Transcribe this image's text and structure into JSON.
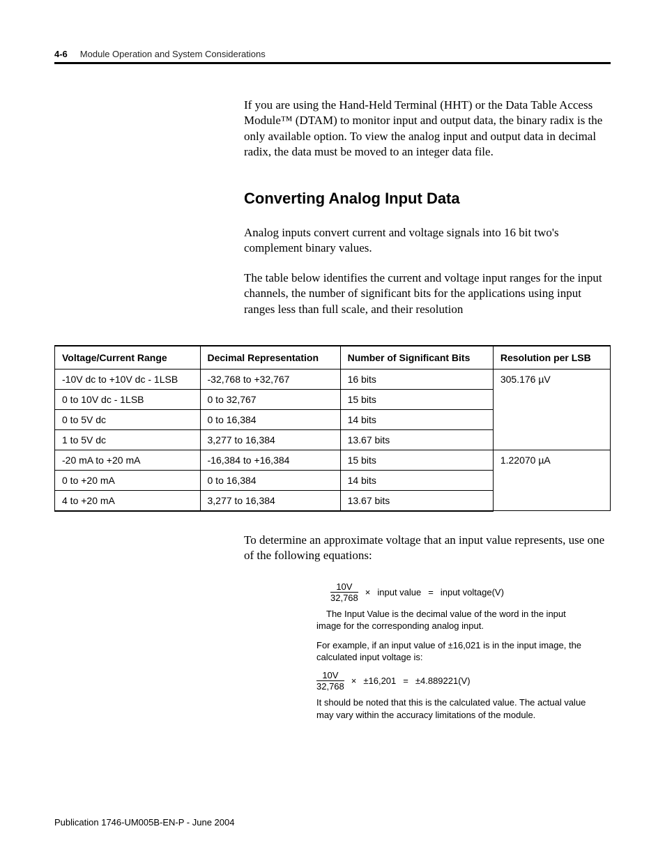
{
  "header": {
    "page_number": "4-6",
    "section_title": "Module Operation and System Considerations"
  },
  "intro_para": "If you are using the Hand-Held Terminal (HHT) or the Data Table Access Module™ (DTAM) to monitor input and output data, the binary radix is the only available option. To view the analog input and output data in decimal radix, the data must be moved to an integer data file.",
  "subhead": "Converting Analog Input Data",
  "para2": "Analog inputs convert current and voltage signals into 16 bit two's complement binary values.",
  "para3": "The table below identifies the current and voltage input ranges for the input channels, the number of significant bits for the applications using input ranges less than full scale, and their resolution",
  "table": {
    "headers": [
      "Voltage/Current Range",
      "Decimal Representation",
      "Number of Significant Bits",
      "Resolution per LSB"
    ],
    "rows": [
      {
        "range": "-10V dc to +10V dc - 1LSB",
        "dec": "-32,768 to +32,767",
        "bits": "16 bits",
        "res": "305.176 µV",
        "res_rowspan": 4
      },
      {
        "range": "0 to 10V dc - 1LSB",
        "dec": "0 to 32,767",
        "bits": "15 bits"
      },
      {
        "range": "0 to 5V dc",
        "dec": "0 to 16,384",
        "bits": "14 bits"
      },
      {
        "range": "1 to 5V dc",
        "dec": "3,277 to 16,384",
        "bits": "13.67 bits"
      },
      {
        "range": "-20 mA to +20 mA",
        "dec": "-16,384 to +16,384",
        "bits": "15 bits",
        "res": "1.22070 µA",
        "res_rowspan": 3
      },
      {
        "range": "0 to +20 mA",
        "dec": "0 to 16,384",
        "bits": "14 bits"
      },
      {
        "range": "4 to +20 mA",
        "dec": "3,277 to 16,384",
        "bits": "13.67 bits"
      }
    ]
  },
  "para4": "To determine an approximate voltage that an input value represents, use one of the following equations:",
  "equation1": {
    "num": "10V",
    "den": "32,768",
    "times": "×",
    "rhs1": "input value",
    "eq": "=",
    "rhs2": "input voltage(V)"
  },
  "note1_indent": "The Input Value is the decimal value of the word in the input image for the corresponding analog input.",
  "note2": "For example, if an input value of ±16,021 is in the input image, the calculated input voltage is:",
  "equation2": {
    "num": "10V",
    "den": "32,768",
    "times": "×",
    "mid": "±16,201",
    "eq": "=",
    "rhs": "±4.889221(V)"
  },
  "note3": "It should be noted that this is the calculated value.  The actual value may vary within the accuracy limitations of the module.",
  "publication": "Publication 1746-UM005B-EN-P - June 2004",
  "chart_data": {
    "type": "table",
    "title": "Analog Input Ranges, Significant Bits and Resolution",
    "columns": [
      "Voltage/Current Range",
      "Decimal Representation",
      "Number of Significant Bits",
      "Resolution per LSB"
    ],
    "rows": [
      [
        "-10V dc to +10V dc - 1LSB",
        "-32,768 to +32,767",
        "16 bits",
        "305.176 µV"
      ],
      [
        "0 to 10V dc - 1LSB",
        "0 to 32,767",
        "15 bits",
        "305.176 µV"
      ],
      [
        "0 to 5V dc",
        "0 to 16,384",
        "14 bits",
        "305.176 µV"
      ],
      [
        "1 to 5V dc",
        "3,277 to 16,384",
        "13.67 bits",
        "305.176 µV"
      ],
      [
        "-20 mA to +20 mA",
        "-16,384 to +16,384",
        "15 bits",
        "1.22070 µA"
      ],
      [
        "0 to +20 mA",
        "0 to 16,384",
        "14 bits",
        "1.22070 µA"
      ],
      [
        "4 to +20 mA",
        "3,277 to 16,384",
        "13.67 bits",
        "1.22070 µA"
      ]
    ]
  }
}
